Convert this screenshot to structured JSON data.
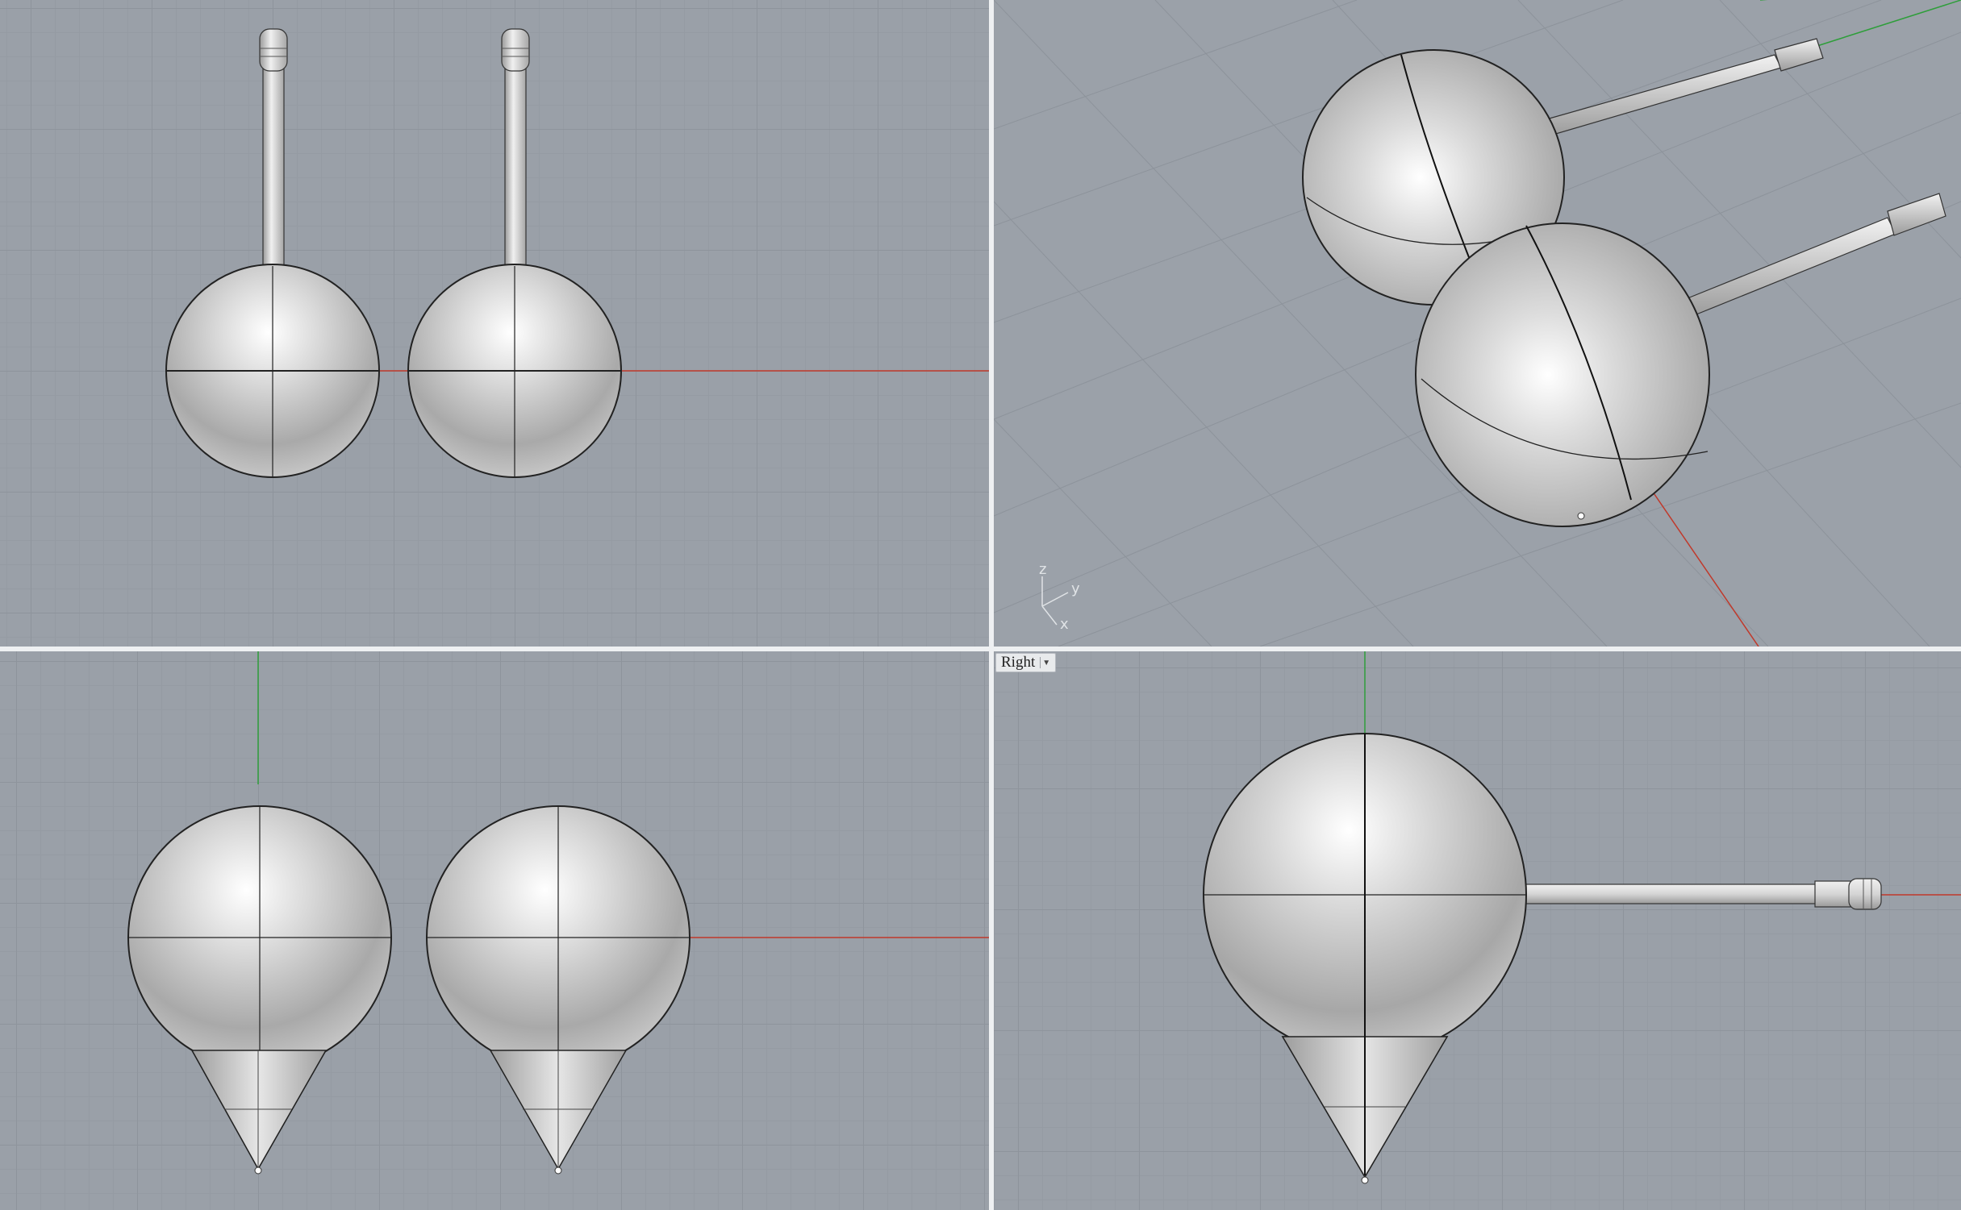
{
  "viewports": [
    {
      "name": "top",
      "tab_label": ""
    },
    {
      "name": "perspective",
      "tab_label": ""
    },
    {
      "name": "front",
      "tab_label": ""
    },
    {
      "name": "right",
      "tab_label": "Right"
    }
  ],
  "axis_indicator": {
    "z": "z",
    "y": "y",
    "x": "x"
  },
  "colors": {
    "viewport_bg": "#9aa0a8",
    "grid_major": "#8e949c",
    "grid_minor": "#959ba3",
    "x_axis": "#c0392b",
    "y_axis": "#2e9e3a",
    "divider": "#eef0f2"
  },
  "icons": {
    "viewport_menu": "chevron-down-icon"
  }
}
